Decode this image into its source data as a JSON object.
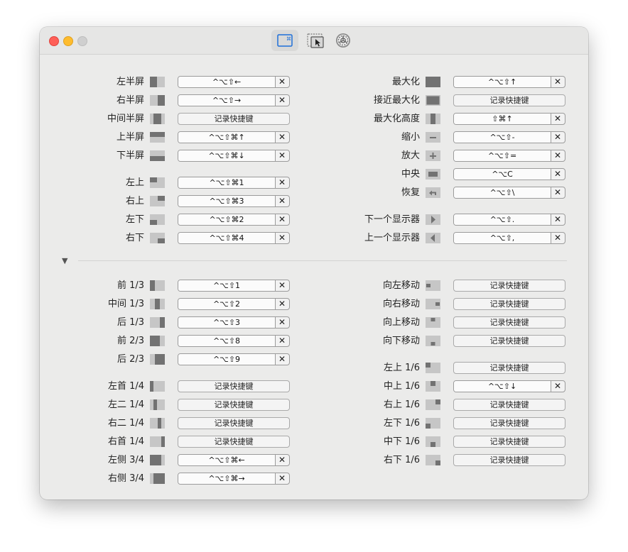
{
  "toolbar": {
    "tabs": [
      {
        "name": "tab-shortcuts",
        "icon": "keyboard-shortcut-icon"
      },
      {
        "name": "tab-snap-areas",
        "icon": "snap-area-icon"
      },
      {
        "name": "tab-settings",
        "icon": "gear-icon"
      }
    ]
  },
  "recordLabel": "记录快捷键",
  "clearGlyph": "✕",
  "toggleGlyph": "▼",
  "colors": {
    "iconDark": "#727272",
    "iconLight": "#c6c6c6"
  },
  "left": [
    {
      "label": "左半屏",
      "icon": "left-half-icon",
      "shortcut": "^⌥⇧←"
    },
    {
      "label": "右半屏",
      "icon": "right-half-icon",
      "shortcut": "^⌥⇧→"
    },
    {
      "label": "中间半屏",
      "icon": "center-half-icon",
      "shortcut": ""
    },
    {
      "label": "上半屏",
      "icon": "top-half-icon",
      "shortcut": "^⌥⇧⌘↑"
    },
    {
      "label": "下半屏",
      "icon": "bottom-half-icon",
      "shortcut": "^⌥⇧⌘↓"
    },
    {
      "label": "左上",
      "icon": "top-left-icon",
      "shortcut": "^⌥⇧⌘1"
    },
    {
      "label": "右上",
      "icon": "top-right-icon",
      "shortcut": "^⌥⇧⌘3"
    },
    {
      "label": "左下",
      "icon": "bottom-left-icon",
      "shortcut": "^⌥⇧⌘2"
    },
    {
      "label": "右下",
      "icon": "bottom-right-icon",
      "shortcut": "^⌥⇧⌘4"
    }
  ],
  "right": [
    {
      "label": "最大化",
      "icon": "maximize-icon",
      "shortcut": "^⌥⇧↑"
    },
    {
      "label": "接近最大化",
      "icon": "almost-maximize-icon",
      "shortcut": ""
    },
    {
      "label": "最大化高度",
      "icon": "maximize-height-icon",
      "shortcut": "⇧⌘↑"
    },
    {
      "label": "缩小",
      "icon": "minus-icon",
      "shortcut": "^⌥⇧-"
    },
    {
      "label": "放大",
      "icon": "plus-icon",
      "shortcut": "^⌥⇧="
    },
    {
      "label": "中央",
      "icon": "center-icon",
      "shortcut": "^⌥C"
    },
    {
      "label": "恢复",
      "icon": "restore-icon",
      "shortcut": "^⌥⇧\\"
    },
    {
      "label": "下一个显示器",
      "icon": "next-display-icon",
      "shortcut": "^⌥⇧."
    },
    {
      "label": "上一个显示器",
      "icon": "previous-display-icon",
      "shortcut": "^⌥⇧,"
    }
  ],
  "left2": [
    {
      "label": "前 1/3",
      "icon": "first-third-icon",
      "shortcut": "^⌥⇧1"
    },
    {
      "label": "中间 1/3",
      "icon": "center-third-icon",
      "shortcut": "^⌥⇧2"
    },
    {
      "label": "后 1/3",
      "icon": "last-third-icon",
      "shortcut": "^⌥⇧3"
    },
    {
      "label": "前 2/3",
      "icon": "first-two-thirds-icon",
      "shortcut": "^⌥⇧8"
    },
    {
      "label": "后 2/3",
      "icon": "last-two-thirds-icon",
      "shortcut": "^⌥⇧9"
    },
    {
      "label": "左首 1/4",
      "icon": "first-fourth-icon",
      "shortcut": ""
    },
    {
      "label": "左二 1/4",
      "icon": "second-fourth-icon",
      "shortcut": ""
    },
    {
      "label": "右二 1/4",
      "icon": "third-fourth-icon",
      "shortcut": ""
    },
    {
      "label": "右首 1/4",
      "icon": "last-fourth-icon",
      "shortcut": ""
    },
    {
      "label": "左侧 3/4",
      "icon": "first-three-fourths-icon",
      "shortcut": "^⌥⇧⌘←"
    },
    {
      "label": "右侧 3/4",
      "icon": "last-three-fourths-icon",
      "shortcut": "^⌥⇧⌘→"
    }
  ],
  "right2": [
    {
      "label": "向左移动",
      "icon": "move-left-icon",
      "shortcut": ""
    },
    {
      "label": "向右移动",
      "icon": "move-right-icon",
      "shortcut": ""
    },
    {
      "label": "向上移动",
      "icon": "move-up-icon",
      "shortcut": ""
    },
    {
      "label": "向下移动",
      "icon": "move-down-icon",
      "shortcut": ""
    },
    {
      "label": "左上 1/6",
      "icon": "top-left-sixth-icon",
      "shortcut": ""
    },
    {
      "label": "中上 1/6",
      "icon": "top-center-sixth-icon",
      "shortcut": "^⌥⇧↓"
    },
    {
      "label": "右上 1/6",
      "icon": "top-right-sixth-icon",
      "shortcut": ""
    },
    {
      "label": "左下 1/6",
      "icon": "bottom-left-sixth-icon",
      "shortcut": ""
    },
    {
      "label": "中下 1/6",
      "icon": "bottom-center-sixth-icon",
      "shortcut": ""
    },
    {
      "label": "右下 1/6",
      "icon": "bottom-right-sixth-icon",
      "shortcut": ""
    }
  ]
}
